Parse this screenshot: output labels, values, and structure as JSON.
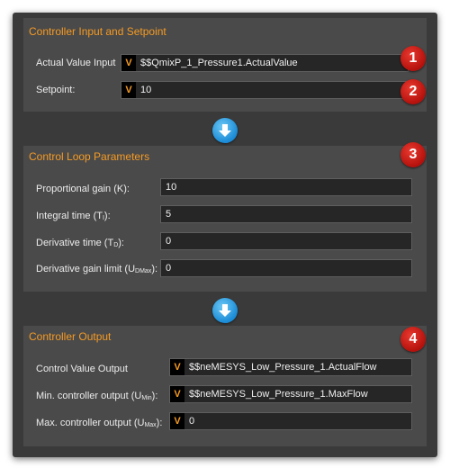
{
  "controller_input": {
    "title": "Controller Input and Setpoint",
    "actual_value_label": "Actual Value Input",
    "actual_value": "$$QmixP_1_Pressure1.ActualValue",
    "setpoint_label": "Setpoint:",
    "setpoint_value": "10",
    "variable_badge": "V",
    "marker_1": "1",
    "marker_2": "2"
  },
  "control_loop": {
    "title": "Control Loop Parameters",
    "marker": "3",
    "proportional_gain": {
      "label": "Proportional gain (K):",
      "value": "10"
    },
    "integral_time": {
      "label_pre": "Integral time (T",
      "label_sub": "I",
      "label_post": "):",
      "value": "5"
    },
    "derivative_time": {
      "label_pre": "Derivative time (T",
      "label_sub": "D",
      "label_post": "):",
      "value": "0"
    },
    "derivative_gain_limit": {
      "label_pre": "Derivative gain limit (U",
      "label_sub": "DMax",
      "label_post": "):",
      "value": "0"
    }
  },
  "controller_output": {
    "title": "Controller Output",
    "marker": "4",
    "variable_badge": "V",
    "control_value_output": {
      "label": "Control Value Output",
      "value": "$$neMESYS_Low_Pressure_1.ActualFlow"
    },
    "min_output": {
      "label_pre": "Min. controller output (U",
      "label_sub": "Min",
      "label_post": "):",
      "value": "$$neMESYS_Low_Pressure_1.MaxFlow"
    },
    "max_output": {
      "label_pre": "Max. controller output (U",
      "label_sub": "Max",
      "label_post": "):",
      "value": "0"
    }
  },
  "colors": {
    "accent_orange": "#f59a23",
    "marker_red": "#c9201a",
    "arrow_blue": "#2a9be0"
  },
  "icons": {
    "flow_arrow": "arrow-down-icon"
  }
}
